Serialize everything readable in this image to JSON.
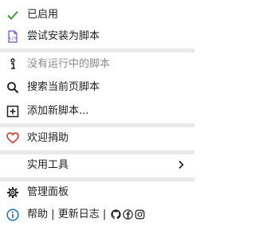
{
  "menu": {
    "enabled": "已启用",
    "try_install": "尝试安装为脚本",
    "no_running": "没有运行中的脚本",
    "search_page": "搜索当前页脚本",
    "add_script": "添加新脚本...",
    "donate": "欢迎捐助",
    "utilities": "实用工具",
    "dashboard": "管理面板",
    "help": "帮助",
    "sep1": "|",
    "changelog": "更新日志",
    "sep2": "|"
  },
  "colors": {
    "check": "#3a9a3a",
    "script_icon": "#7a4ac2",
    "heart": "#d9342b",
    "info": "#1a73b8",
    "separator": "#e9e9e9"
  }
}
